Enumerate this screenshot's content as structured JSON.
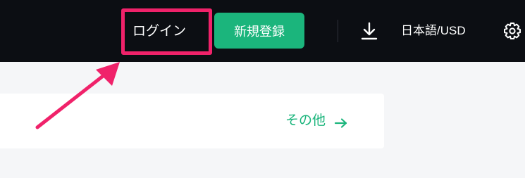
{
  "header": {
    "login_label": "ログイン",
    "signup_label": "新規登録",
    "download_icon": "download-icon",
    "language_currency": "日本語/USD",
    "settings_icon": "gear-icon"
  },
  "card": {
    "more_label": "その他",
    "more_icon": "arrow-right-icon"
  },
  "colors": {
    "topbar_bg": "#0c0e13",
    "accent_green": "#1bb57c",
    "annotation_pink": "#f0226a",
    "page_bg": "#f5f6f8"
  }
}
